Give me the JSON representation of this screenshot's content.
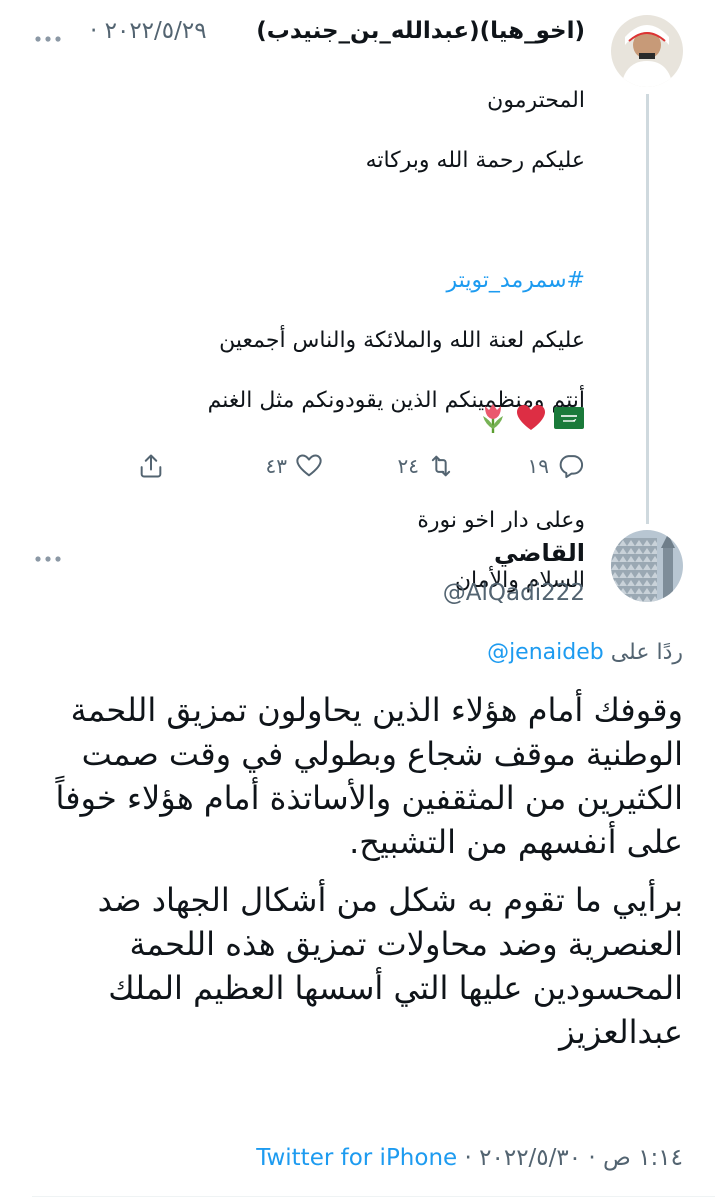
{
  "tweet1": {
    "display_name": "(اخو_هيا)(عبدالله_بن_جنيدب)",
    "date": "· ٢٠٢٢/٥/٢٩",
    "body_line1": "المحترمون",
    "body_line2": "عليكم رحمة الله وبركاته",
    "hashtag": "#سمرمد_تويتر",
    "body_line3": "عليكم لعنة الله والملائكة والناس أجمعين",
    "body_line4": "أنتم ومنظمينكم الذين يقودونكم مثل الغنم",
    "body_line5": "وعلى دار اخو نورة",
    "body_line6": "السلام والأمان",
    "emojis": [
      "saudi-flag",
      "red-heart",
      "tulip"
    ],
    "reply_count": "١٩",
    "retweet_count": "٢٤",
    "like_count": "٤٣"
  },
  "tweet2": {
    "display_name": "القاضي",
    "handle": "@AlQadi222",
    "reply_prefix": "ردًا على",
    "reply_to": "@jenaideb",
    "paragraph1": "وقوفك أمام هؤلاء الذين يحاولون تمزيق اللحمة الوطنية موقف شجاع وبطولي في وقت صمت الكثيرين من المثقفين والأساتذة أمام هؤلاء خوفاً على أنفسهم من التشبيح.",
    "paragraph2": "برأيي ما تقوم به شكل من أشكال الجهاد ضد العنصرية وضد محاولات تمزيق هذه اللحمة المحسودين عليها التي أسسها العظيم الملك عبدالعزيز",
    "timestamp": "١:١٤ ص · ٢٠٢٢/٥/٣٠ ·",
    "client": "Twitter for iPhone"
  },
  "colors": {
    "accent": "#1d9bf0",
    "secondary_text": "#536471",
    "primary_text": "#0f1419",
    "thread_line": "#cfd9de"
  }
}
